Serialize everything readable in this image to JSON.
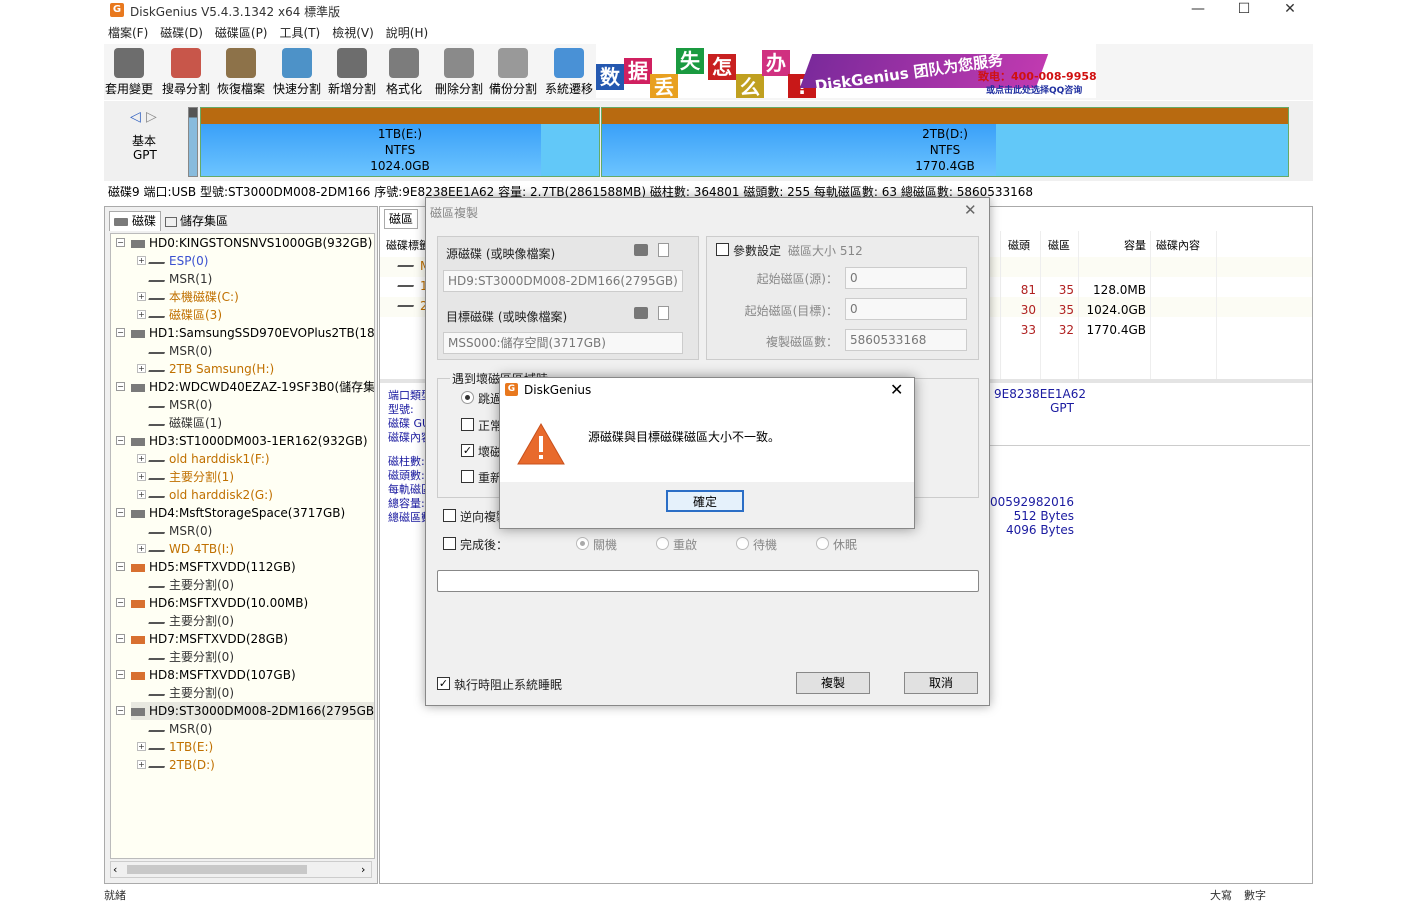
{
  "window": {
    "title": "DiskGenius V5.4.3.1342 x64 標準版"
  },
  "menu": [
    "檔案(F)",
    "磁碟(D)",
    "磁碟區(P)",
    "工具(T)",
    "檢視(V)",
    "說明(H)"
  ],
  "toolbar": [
    {
      "label": "套用變更",
      "icon": "save-icon",
      "color": "#555555"
    },
    {
      "label": "搜尋分割",
      "icon": "search-icon",
      "color": "#c0392b"
    },
    {
      "label": "恢復檔案",
      "icon": "recover-icon",
      "color": "#7a5a2a"
    },
    {
      "label": "快速分割",
      "icon": "quick-partition-icon",
      "color": "#2f80c0"
    },
    {
      "label": "新增分割",
      "icon": "new-partition-icon",
      "color": "#555555"
    },
    {
      "label": "格式化",
      "icon": "format-icon",
      "color": "#666666"
    },
    {
      "label": "刪除分割",
      "icon": "delete-icon",
      "color": "#777777"
    },
    {
      "label": "備份分割",
      "icon": "backup-icon",
      "color": "#888888"
    },
    {
      "label": "系統遷移",
      "icon": "migrate-icon",
      "color": "#2a7fd0"
    }
  ],
  "banner": {
    "chars": [
      "数",
      "据",
      "丢",
      "失",
      "怎",
      "么",
      "办",
      "!"
    ],
    "slogan": "DiskGenius 团队为您服务",
    "phone": "致电：400-008-9958",
    "qq": "或点击此处选择QQ咨询"
  },
  "diskbar": {
    "nav_label_1": "基本",
    "nav_label_2": "GPT",
    "partitions": [
      {
        "name": "1TB(E:)",
        "fs": "NTFS",
        "size": "1024.0GB"
      },
      {
        "name": "2TB(D:)",
        "fs": "NTFS",
        "size": "1770.4GB"
      }
    ]
  },
  "diskinfo": "磁碟9 端口:USB  型號:ST3000DM008-2DM166  序號:9E8238EE1A62  容量: 2.7TB(2861588MB)  磁柱數: 364801  磁頭數: 255  每軌磁區數: 63  總磁區數: 5860533168",
  "tree_tabs": [
    "磁碟",
    "儲存集區"
  ],
  "tree": [
    {
      "lvl": 0,
      "text": "HD0:KINGSTONSNVS1000GB(932GB)",
      "type": "disk",
      "color": "#000000"
    },
    {
      "lvl": 1,
      "text": "ESP(0)",
      "type": "part",
      "color": "#3a50d0",
      "exp": true
    },
    {
      "lvl": 1,
      "text": "MSR(1)",
      "type": "part",
      "color": "#333333",
      "exp": false
    },
    {
      "lvl": 1,
      "text": "本機磁碟(C:)",
      "type": "part",
      "color": "#c07000",
      "exp": true
    },
    {
      "lvl": 1,
      "text": "磁碟區(3)",
      "type": "part",
      "color": "#c07000",
      "exp": true
    },
    {
      "lvl": 0,
      "text": "HD1:SamsungSSD970EVOPlus2TB(18",
      "type": "disk",
      "color": "#000000"
    },
    {
      "lvl": 1,
      "text": "MSR(0)",
      "type": "part",
      "color": "#333333",
      "exp": false
    },
    {
      "lvl": 1,
      "text": "2TB Samsung(H:)",
      "type": "part",
      "color": "#c07000",
      "exp": true
    },
    {
      "lvl": 0,
      "text": "HD2:WDCWD40EZAZ-19SF3B0(儲存集",
      "type": "disk",
      "color": "#000000"
    },
    {
      "lvl": 1,
      "text": "MSR(0)",
      "type": "part",
      "color": "#333333",
      "exp": false
    },
    {
      "lvl": 1,
      "text": "磁碟區(1)",
      "type": "part",
      "color": "#333333",
      "exp": false
    },
    {
      "lvl": 0,
      "text": "HD3:ST1000DM003-1ER162(932GB)",
      "type": "disk",
      "color": "#000000"
    },
    {
      "lvl": 1,
      "text": "old harddisk1(F:)",
      "type": "part",
      "color": "#c07000",
      "exp": true
    },
    {
      "lvl": 1,
      "text": "主要分割(1)",
      "type": "part",
      "color": "#c07000",
      "exp": true
    },
    {
      "lvl": 1,
      "text": "old harddisk2(G:)",
      "type": "part",
      "color": "#c07000",
      "exp": true
    },
    {
      "lvl": 0,
      "text": "HD4:MsftStorageSpace(3717GB)",
      "type": "disk",
      "color": "#000000"
    },
    {
      "lvl": 1,
      "text": "MSR(0)",
      "type": "part",
      "color": "#333333",
      "exp": false
    },
    {
      "lvl": 1,
      "text": "WD 4TB(I:)",
      "type": "part",
      "color": "#c07000",
      "exp": true
    },
    {
      "lvl": 0,
      "text": "HD5:MSFTXVDD(112GB)",
      "type": "vdisk",
      "color": "#000000"
    },
    {
      "lvl": 1,
      "text": "主要分割(0)",
      "type": "part",
      "color": "#333333",
      "exp": false
    },
    {
      "lvl": 0,
      "text": "HD6:MSFTXVDD(10.00MB)",
      "type": "vdisk",
      "color": "#000000"
    },
    {
      "lvl": 1,
      "text": "主要分割(0)",
      "type": "part",
      "color": "#333333",
      "exp": false
    },
    {
      "lvl": 0,
      "text": "HD7:MSFTXVDD(28GB)",
      "type": "vdisk",
      "color": "#000000"
    },
    {
      "lvl": 1,
      "text": "主要分割(0)",
      "type": "part",
      "color": "#333333",
      "exp": false
    },
    {
      "lvl": 0,
      "text": "HD8:MSFTXVDD(107GB)",
      "type": "vdisk",
      "color": "#000000"
    },
    {
      "lvl": 1,
      "text": "主要分割(0)",
      "type": "part",
      "color": "#333333",
      "exp": false
    },
    {
      "lvl": 0,
      "text": "HD9:ST3000DM008-2DM166(2795GB",
      "type": "disk",
      "color": "#000000",
      "selected": true
    },
    {
      "lvl": 1,
      "text": "MSR(0)",
      "type": "part",
      "color": "#333333",
      "exp": false
    },
    {
      "lvl": 1,
      "text": "1TB(E:)",
      "type": "part",
      "color": "#c07000",
      "exp": true
    },
    {
      "lvl": 1,
      "text": "2TB(D:)",
      "type": "part",
      "color": "#c07000",
      "exp": true
    }
  ],
  "right": {
    "tab": "磁區",
    "col_label": "磁碟標籤",
    "row_chars": [
      "M",
      "1",
      "2"
    ],
    "headers": [
      "磁頭",
      "磁區",
      "容量",
      "磁碟內容"
    ],
    "rows": [
      {
        "head": "81",
        "sector": "35",
        "cap": "128.0MB"
      },
      {
        "head": "30",
        "sector": "35",
        "cap": "1024.0GB"
      },
      {
        "head": "33",
        "sector": "32",
        "cap": "1770.4GB"
      }
    ],
    "info_labels": [
      "端口類型:",
      "型號:",
      "磁碟 GU",
      "磁碟內容"
    ],
    "info_labels2": [
      "磁柱數:",
      "磁頭數:",
      "每軌磁區",
      "總容量:",
      "總磁區數"
    ],
    "serial": "9E8238EE1A62",
    "part_style": "GPT",
    "bytes_total": "000592982016",
    "sector_size": "512 Bytes",
    "phys_sector": "4096 Bytes"
  },
  "status": {
    "left": "就緒",
    "caps": "大寫",
    "num": "數字"
  },
  "copy_dialog": {
    "title": "磁區複製",
    "src_label": "源磁碟 (或映像檔案)",
    "src_value": "HD9:ST3000DM008-2DM166(2795GB)",
    "dst_label": "目標磁碟 (或映像檔案)",
    "dst_value": "MSS000:儲存空間(3717GB)",
    "param_label": "參數設定",
    "sector_size": "磁區大小 512",
    "start_src_label": "起始磁區(源)：",
    "start_src_value": "0",
    "start_dst_label": "起始磁區(目標)：",
    "start_dst_value": "0",
    "count_label": "複製磁區數：",
    "count_value": "5860533168",
    "bad_group": "遇到壞磁區區域時",
    "opt_skip": "跳過",
    "opt_normal": "正常",
    "opt_bad": "壞磁",
    "opt_retry": "重新",
    "reverse": "逆向複製",
    "after_label": "完成後：",
    "after_options": [
      "關機",
      "重啟",
      "待機",
      "休眠"
    ],
    "prevent_sleep": "執行時阻止系統睡眠",
    "copy_btn": "複製",
    "cancel_btn": "取消"
  },
  "message_box": {
    "title": "DiskGenius",
    "text": "源磁碟與目標磁碟磁區大小不一致。",
    "ok": "確定"
  }
}
